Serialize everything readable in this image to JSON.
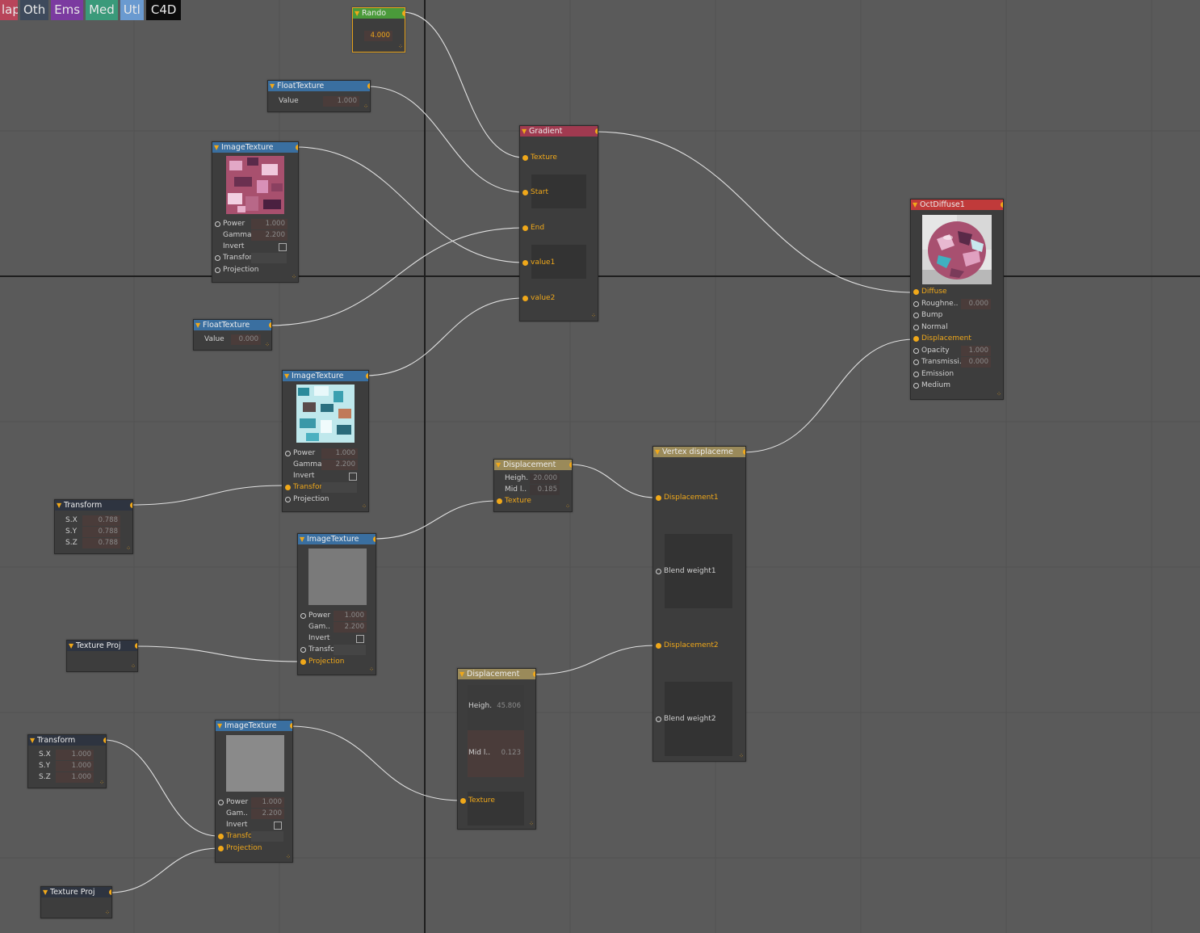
{
  "toolbar": {
    "tabs": [
      {
        "label": "lap",
        "color": "#b8455a"
      },
      {
        "label": "Oth",
        "color": "#3e4a5c"
      },
      {
        "label": "Ems",
        "color": "#7b3aa0"
      },
      {
        "label": "Med",
        "color": "#3a9a7a"
      },
      {
        "label": "Utl",
        "color": "#6a9ad0"
      },
      {
        "label": "C4D",
        "color": "#0c0c0c"
      }
    ]
  },
  "colors": {
    "accent": "#f0a81a",
    "background": "#5a5a5a",
    "wire": "#e0e0e0"
  },
  "nodes": {
    "rando": {
      "title": "Rando",
      "value": "4.000"
    },
    "float1": {
      "title": "FloatTexture",
      "value_label": "Value",
      "value": "1.000"
    },
    "image1": {
      "title": "ImageTexture",
      "power_label": "Power",
      "power": "1.000",
      "gamma_label": "Gamma",
      "gamma": "2.200",
      "invert_label": "Invert",
      "transform_label": "Transform",
      "projection_label": "Projection"
    },
    "float2": {
      "title": "FloatTexture",
      "value_label": "Value",
      "value": "0.000"
    },
    "image2": {
      "title": "ImageTexture",
      "power_label": "Power",
      "power": "1.000",
      "gamma_label": "Gamma",
      "gamma": "2.200",
      "invert_label": "Invert",
      "transform_label": "Transform",
      "projection_label": "Projection"
    },
    "transform1": {
      "title": "Transform",
      "sx_label": "S.X",
      "sx": "0.788",
      "sy_label": "S.Y",
      "sy": "0.788",
      "sz_label": "S.Z",
      "sz": "0.788"
    },
    "image3": {
      "title": "ImageTexture",
      "power_label": "Power",
      "power": "1.000",
      "gamma_label": "Gam..",
      "gamma": "2.200",
      "invert_label": "Invert",
      "transform_label": "Transform",
      "projection_label": "Projection"
    },
    "texproj1": {
      "title": "Texture Proj"
    },
    "transform2": {
      "title": "Transform",
      "sx_label": "S.X",
      "sx": "1.000",
      "sy_label": "S.Y",
      "sy": "1.000",
      "sz_label": "S.Z",
      "sz": "1.000"
    },
    "image4": {
      "title": "ImageTexture",
      "power_label": "Power",
      "power": "1.000",
      "gamma_label": "Gam..",
      "gamma": "2.200",
      "invert_label": "Invert",
      "transform_label": "Transform",
      "projection_label": "Projection"
    },
    "texproj2": {
      "title": "Texture Proj"
    },
    "gradient": {
      "title": "Gradient",
      "texture_label": "Texture",
      "start_label": "Start",
      "end_label": "End",
      "value1_label": "value1",
      "value2_label": "value2"
    },
    "disp1": {
      "title": "Displacement",
      "height_label": "Heigh.",
      "height": "20.000",
      "mid_label": "Mid l..",
      "mid": "0.185",
      "texture_label": "Texture"
    },
    "disp2": {
      "title": "Displacement",
      "height_label": "Heigh.",
      "height": "45.806",
      "mid_label": "Mid l..",
      "mid": "0.123",
      "texture_label": "Texture"
    },
    "vertex": {
      "title": "Vertex displaceme",
      "d1_label": "Displacement1",
      "bw1_label": "Blend weight1",
      "d2_label": "Displacement2",
      "bw2_label": "Blend weight2"
    },
    "diffuse": {
      "title": "OctDiffuse1",
      "diffuse_label": "Diffuse",
      "rough_label": "Roughne..",
      "rough": "0.000",
      "bump_label": "Bump",
      "normal_label": "Normal",
      "disp_label": "Displacement",
      "opacity_label": "Opacity",
      "opacity": "1.000",
      "trans_label": "Transmissi..",
      "trans": "0.000",
      "emission_label": "Emission",
      "medium_label": "Medium"
    }
  }
}
